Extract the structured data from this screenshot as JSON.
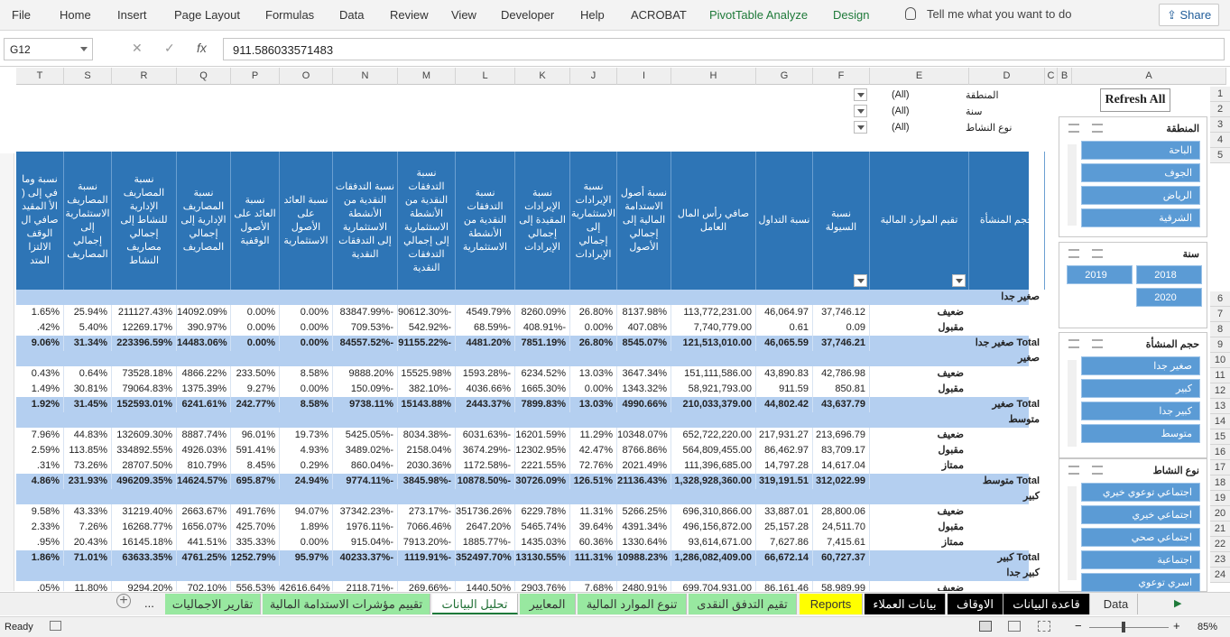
{
  "ribbon": {
    "tabs": [
      "File",
      "Home",
      "Insert",
      "Page Layout",
      "Formulas",
      "Data",
      "Review",
      "View",
      "Developer",
      "Help",
      "ACROBAT",
      "PivotTable Analyze",
      "Design"
    ],
    "tell_me": "Tell me what you want to do",
    "share": "Share"
  },
  "formula_bar": {
    "name_box": "G12",
    "cancel": "✕",
    "enter": "✓",
    "fx": "fx",
    "formula": "911.586033571483"
  },
  "columns": [
    "T",
    "S",
    "R",
    "Q",
    "P",
    "O",
    "N",
    "M",
    "L",
    "K",
    "J",
    "I",
    "H",
    "G",
    "F",
    "E",
    "D",
    "C",
    "B",
    "A"
  ],
  "row_numbers": [
    "1",
    "2",
    "3",
    "4",
    "5",
    "6",
    "7",
    "8",
    "9",
    "10",
    "11",
    "12",
    "13",
    "14",
    "15",
    "16",
    "17",
    "18",
    "19",
    "20",
    "21",
    "22",
    "23",
    "24"
  ],
  "filters": [
    {
      "label": "المنطقة",
      "value": "(All)"
    },
    {
      "label": "سنة",
      "value": "(All)"
    },
    {
      "label": "نوع النشاط",
      "value": "(All)"
    }
  ],
  "headers": {
    "D": "حجم المنشأة",
    "E": "تقيم الموارد المالية",
    "F": "نسبة السيولة",
    "G": "نسبة التداول",
    "H": "صافي رأس المال العامل",
    "I": "نسبة أصول الاستدامة المالية إلى إجمالي الأصول",
    "J": "نسبة الإيرادات الاستثمارية إلى إجمالي الإيرادات",
    "K": "نسبة الإيرادات المقيدة إلى إجمالي الإيرادات",
    "L": "نسبة التدفقات النقدية من الأنشطة الاستثمارية",
    "M": "نسبة التدفقات النقدية من الأنشطة الاستثمارية إلى إجمالي التدفقات النقدية",
    "N": "نسبة التدفقات النقدية من الأنشطة الاستثمارية إلى التدفقات النقدية",
    "O": "نسبة العائد على الأصول الاستثمارية",
    "P": "نسبة العائد على الأصول الوقفية",
    "Q": "نسبة المصاريف الإدارية إلى إجمالي المصاريف",
    "R": "نسبة المصاريف الإدارية للنشاط إلى إجمالي مصاريف النشاط",
    "S": "نسبة المصاريف الاستثمارية إلى إجمالي المصاريف",
    "T": "نسبة وما في إلى ( الأ المقيد صافي ال الوقف الالتزا المتد"
  },
  "rows": [
    {
      "type": "cat",
      "label": "صغير جدا",
      "vals": []
    },
    {
      "type": "sub",
      "label": "ضعيف",
      "vals": [
        "1.65%",
        "25.94%",
        "211127.43%",
        "14092.09%",
        "0.00%",
        "0.00%",
        "83847.99%-",
        "90612.30%-",
        "4549.79%",
        "8260.09%",
        "26.80%",
        "8137.98%",
        "113,772,231.00",
        "46,064.97",
        "37,746.12"
      ]
    },
    {
      "type": "sub",
      "label": "مقبول",
      "vals": [
        ".42%",
        "5.40%",
        "12269.17%",
        "390.97%",
        "0.00%",
        "0.00%",
        "709.53%-",
        "542.92%-",
        "68.59%-",
        "408.91%-",
        "0.00%",
        "407.08%",
        "7,740,779.00",
        "0.61",
        "0.09"
      ]
    },
    {
      "type": "tot",
      "label": "صغير جدا Total",
      "vals": [
        "9.06%",
        "31.34%",
        "223396.59%",
        "14483.06%",
        "0.00%",
        "0.00%",
        "84557.52%-",
        "91155.22%-",
        "4481.20%",
        "7851.19%",
        "26.80%",
        "8545.07%",
        "121,513,010.00",
        "46,065.59",
        "37,746.21"
      ]
    },
    {
      "type": "cat",
      "label": "صغير",
      "vals": []
    },
    {
      "type": "sub",
      "label": "ضعيف",
      "vals": [
        "0.43%",
        "0.64%",
        "73528.18%",
        "4866.22%",
        "233.50%",
        "8.58%",
        "9888.20%",
        "15525.98%",
        "1593.28%-",
        "6234.52%",
        "13.03%",
        "3647.34%",
        "151,111,586.00",
        "43,890.83",
        "42,786.98"
      ]
    },
    {
      "type": "sub",
      "label": "مقبول",
      "vals": [
        "1.49%",
        "30.81%",
        "79064.83%",
        "1375.39%",
        "9.27%",
        "0.00%",
        "150.09%-",
        "382.10%-",
        "4036.66%",
        "1665.30%",
        "0.00%",
        "1343.32%",
        "58,921,793.00",
        "911.59",
        "850.81"
      ]
    },
    {
      "type": "tot",
      "label": "صغير Total",
      "vals": [
        "1.92%",
        "31.45%",
        "152593.01%",
        "6241.61%",
        "242.77%",
        "8.58%",
        "9738.11%",
        "15143.88%",
        "2443.37%",
        "7899.83%",
        "13.03%",
        "4990.66%",
        "210,033,379.00",
        "44,802.42",
        "43,637.79"
      ]
    },
    {
      "type": "cat",
      "label": "متوسط",
      "vals": []
    },
    {
      "type": "sub",
      "label": "ضعيف",
      "vals": [
        "7.96%",
        "44.83%",
        "132609.30%",
        "8887.74%",
        "96.01%",
        "19.73%",
        "5425.05%-",
        "8034.38%-",
        "6031.63%-",
        "16201.59%",
        "11.29%",
        "10348.07%",
        "652,722,220.00",
        "217,931.27",
        "213,696.79"
      ]
    },
    {
      "type": "sub",
      "label": "مقبول",
      "vals": [
        "2.59%",
        "113.85%",
        "334892.55%",
        "4926.03%",
        "591.41%",
        "4.93%",
        "3489.02%-",
        "2158.04%",
        "3674.29%-",
        "12302.95%",
        "42.47%",
        "8766.86%",
        "564,809,455.00",
        "86,462.97",
        "83,709.17"
      ]
    },
    {
      "type": "sub",
      "label": "ممتاز",
      "vals": [
        ".31%",
        "73.26%",
        "28707.50%",
        "810.79%",
        "8.45%",
        "0.29%",
        "860.04%-",
        "2030.36%",
        "1172.58%-",
        "2221.55%",
        "72.76%",
        "2021.49%",
        "111,396,685.00",
        "14,797.28",
        "14,617.04"
      ]
    },
    {
      "type": "tot",
      "label": "متوسط Total",
      "vals": [
        "4.86%",
        "231.93%",
        "496209.35%",
        "14624.57%",
        "695.87%",
        "24.94%",
        "9774.11%-",
        "3845.98%-",
        "10878.50%-",
        "30726.09%",
        "126.51%",
        "21136.43%",
        "1,328,928,360.00",
        "319,191.51",
        "312,022.99"
      ]
    },
    {
      "type": "cat",
      "label": "كبير",
      "vals": []
    },
    {
      "type": "sub",
      "label": "ضعيف",
      "vals": [
        "9.58%",
        "43.33%",
        "31219.40%",
        "2663.67%",
        "491.76%",
        "94.07%",
        "37342.23%-",
        "273.17%-",
        "351736.26%",
        "6229.78%",
        "11.31%",
        "5266.25%",
        "696,310,866.00",
        "33,887.01",
        "28,800.06"
      ]
    },
    {
      "type": "sub",
      "label": "مقبول",
      "vals": [
        "2.33%",
        "7.26%",
        "16268.77%",
        "1656.07%",
        "425.70%",
        "1.89%",
        "1976.11%-",
        "7066.46%",
        "2647.20%",
        "5465.74%",
        "39.64%",
        "4391.34%",
        "496,156,872.00",
        "25,157.28",
        "24,511.70"
      ]
    },
    {
      "type": "sub",
      "label": "ممتاز",
      "vals": [
        ".95%",
        "20.43%",
        "16145.18%",
        "441.51%",
        "335.33%",
        "0.00%",
        "915.04%-",
        "7913.20%-",
        "1885.77%-",
        "1435.03%",
        "60.36%",
        "1330.64%",
        "93,614,671.00",
        "7,627.86",
        "7,415.61"
      ]
    },
    {
      "type": "tot",
      "label": "كبير Total",
      "vals": [
        "1.86%",
        "71.01%",
        "63633.35%",
        "4761.25%",
        "1252.79%",
        "95.97%",
        "40233.37%-",
        "1119.91%-",
        "352497.70%",
        "13130.55%",
        "111.31%",
        "10988.23%",
        "1,286,082,409.00",
        "66,672.14",
        "60,727.37"
      ]
    },
    {
      "type": "cat",
      "label": "كبير جدا",
      "vals": []
    },
    {
      "type": "sub",
      "label": "ضعيف",
      "vals": [
        ".05%",
        "11.80%",
        "9294.20%",
        "702.10%",
        "556.53%",
        "42616.64%",
        "2118.71%-",
        "269.66%-",
        "1440.50%",
        "2903.76%",
        "7.68%",
        "2480.91%",
        "699,704,931.00",
        "86,161.46",
        "58,989.99"
      ]
    }
  ],
  "slicers": {
    "refresh": "Refresh All",
    "region": {
      "title": "المنطقة",
      "items": [
        "الباحة",
        "الجوف",
        "الرياض",
        "الشرقية"
      ]
    },
    "year": {
      "title": "سنة",
      "items": [
        "2018",
        "2019",
        "2020"
      ]
    },
    "size": {
      "title": "حجم المنشأة",
      "items": [
        "صغير جدا",
        "كبير",
        "كبير جدا",
        "متوسط"
      ]
    },
    "activity": {
      "title": "نوع النشاط",
      "items": [
        "اجتماعي توعوي خيري",
        "اجتماعي خيري",
        "اجتماعي صحي",
        "اجتماعية",
        "اسري توعوي"
      ]
    }
  },
  "sheet_tabs": [
    "Data",
    "قاعدة البيانات",
    "الاوقاف",
    "بيانات العملاء",
    "Reports",
    "تقيم التدفق النقدى",
    "تنوع الموارد المالية",
    "المعايير",
    "تحليل البيانات",
    "تقييم مؤشرات الاستدامة المالية",
    "تقارير الاجماليات"
  ],
  "status": {
    "ready": "Ready",
    "zoom": "85%",
    "ellipsis": "...",
    "add": "+"
  }
}
